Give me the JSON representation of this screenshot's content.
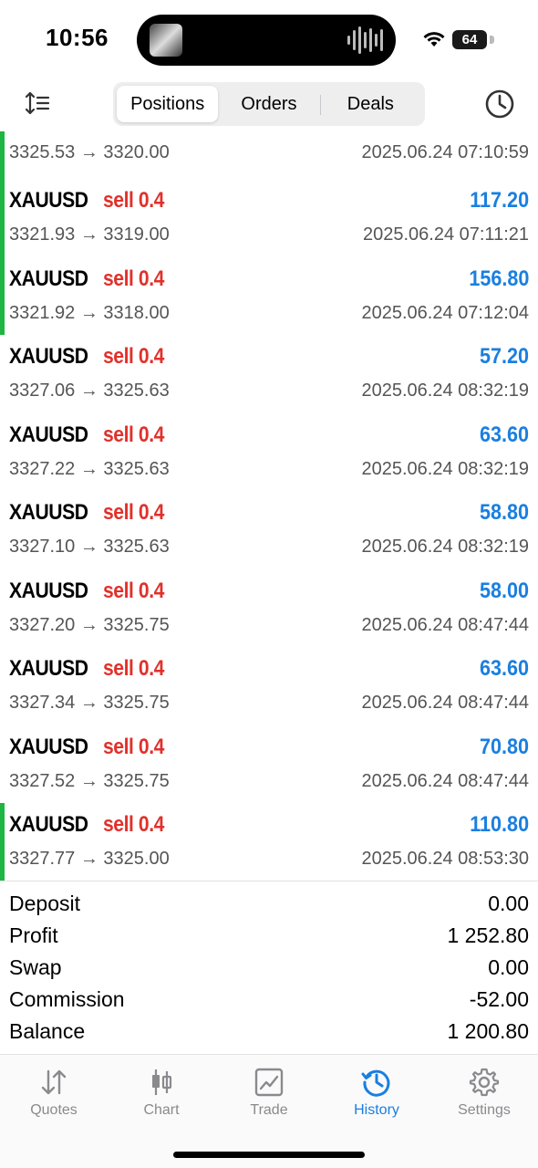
{
  "status_bar": {
    "time": "10:56",
    "battery": "64"
  },
  "header": {
    "tabs": [
      "Positions",
      "Orders",
      "Deals"
    ],
    "active_tab": "Positions"
  },
  "deals": [
    {
      "prices": "3325.53 → 3320.00",
      "time": "2025.06.24 07:10:59",
      "accent": true,
      "partial": true
    },
    {
      "symbol": "XAUUSD",
      "side": "sell 0.4",
      "profit": "117.20",
      "prices": "3321.93 → 3319.00",
      "time": "2025.06.24 07:11:21",
      "accent": true
    },
    {
      "symbol": "XAUUSD",
      "side": "sell 0.4",
      "profit": "156.80",
      "prices": "3321.92 → 3318.00",
      "time": "2025.06.24 07:12:04",
      "accent": true
    },
    {
      "symbol": "XAUUSD",
      "side": "sell 0.4",
      "profit": "57.20",
      "prices": "3327.06 → 3325.63",
      "time": "2025.06.24 08:32:19",
      "accent": false
    },
    {
      "symbol": "XAUUSD",
      "side": "sell 0.4",
      "profit": "63.60",
      "prices": "3327.22 → 3325.63",
      "time": "2025.06.24 08:32:19",
      "accent": false
    },
    {
      "symbol": "XAUUSD",
      "side": "sell 0.4",
      "profit": "58.80",
      "prices": "3327.10 → 3325.63",
      "time": "2025.06.24 08:32:19",
      "accent": false
    },
    {
      "symbol": "XAUUSD",
      "side": "sell 0.4",
      "profit": "58.00",
      "prices": "3327.20 → 3325.75",
      "time": "2025.06.24 08:47:44",
      "accent": false
    },
    {
      "symbol": "XAUUSD",
      "side": "sell 0.4",
      "profit": "63.60",
      "prices": "3327.34 → 3325.75",
      "time": "2025.06.24 08:47:44",
      "accent": false
    },
    {
      "symbol": "XAUUSD",
      "side": "sell 0.4",
      "profit": "70.80",
      "prices": "3327.52 → 3325.75",
      "time": "2025.06.24 08:47:44",
      "accent": false
    },
    {
      "symbol": "XAUUSD",
      "side": "sell 0.4",
      "profit": "110.80",
      "prices": "3327.77 → 3325.00",
      "time": "2025.06.24 08:53:30",
      "accent": true
    }
  ],
  "summary": [
    {
      "label": "Deposit",
      "value": "0.00"
    },
    {
      "label": "Profit",
      "value": "1 252.80"
    },
    {
      "label": "Swap",
      "value": "0.00"
    },
    {
      "label": "Commission",
      "value": "-52.00"
    },
    {
      "label": "Balance",
      "value": "1 200.80"
    }
  ],
  "tabbar": [
    {
      "label": "Quotes",
      "icon": "quotes-arrows-icon"
    },
    {
      "label": "Chart",
      "icon": "candlestick-icon"
    },
    {
      "label": "Trade",
      "icon": "trade-chart-icon"
    },
    {
      "label": "History",
      "icon": "history-clock-icon",
      "active": true
    },
    {
      "label": "Settings",
      "icon": "gear-icon"
    }
  ],
  "colors": {
    "accent_green": "#1fb543",
    "sell_red": "#e0312b",
    "profit_blue": "#1a7fe0",
    "tab_active": "#1a7fe0",
    "tab_inactive": "#8a8a8e"
  }
}
